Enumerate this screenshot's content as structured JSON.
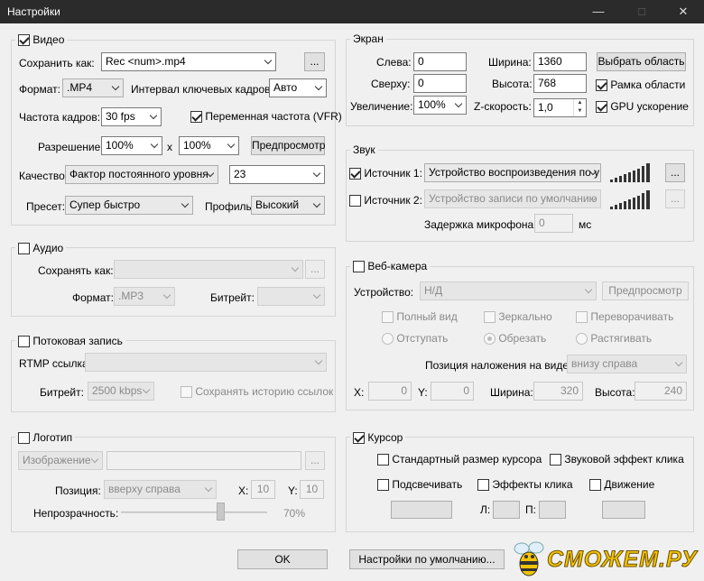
{
  "window": {
    "title": "Настройки"
  },
  "video": {
    "title": "Видео",
    "save_as_label": "Сохранить как:",
    "save_as_value": "Rec <num>.mp4",
    "browse": "...",
    "format_label": "Формат:",
    "format_value": ".MP4",
    "keyframe_label": "Интервал ключевых кадров:",
    "keyframe_value": "Авто",
    "fps_label": "Частота кадров:",
    "fps_value": "30 fps",
    "vfr_label": "Переменная частота (VFR)",
    "resolution_label": "Разрешение:",
    "res_w": "100%",
    "res_x": "x",
    "res_h": "100%",
    "preview": "Предпросмотр",
    "quality_label": "Качество:",
    "quality_value": "Фактор постоянного уровня",
    "quality_num": "23",
    "preset_label": "Пресет:",
    "preset_value": "Супер быстро",
    "profile_label": "Профиль:",
    "profile_value": "Высокий"
  },
  "audio": {
    "title": "Аудио",
    "save_as_label": "Сохранять как:",
    "browse": "...",
    "format_label": "Формат:",
    "format_value": ".MP3",
    "bitrate_label": "Битрейт:"
  },
  "stream": {
    "title": "Потоковая запись",
    "rtmp_label": "RTMP ссылка:",
    "bitrate_label": "Битрейт:",
    "bitrate_value": "2500 kbps",
    "history_label": "Сохранять историю ссылок"
  },
  "logo": {
    "title": "Логотип",
    "type_value": "Изображение",
    "browse": "...",
    "position_label": "Позиция:",
    "position_value": "вверху справа",
    "x_label": "X:",
    "x_value": "10",
    "y_label": "Y:",
    "y_value": "10",
    "opacity_label": "Непрозрачность:",
    "opacity_value": "70%"
  },
  "screen": {
    "title": "Экран",
    "left_label": "Слева:",
    "left_value": "0",
    "top_label": "Сверху:",
    "top_value": "0",
    "width_label": "Ширина:",
    "width_value": "1360",
    "height_label": "Высота:",
    "height_value": "768",
    "select_area": "Выбрать область",
    "frame_label": "Рамка области",
    "zoom_label": "Увеличение:",
    "zoom_value": "100%",
    "zspeed_label": "Z-скорость:",
    "zspeed_value": "1,0",
    "gpu_label": "GPU ускорение"
  },
  "sound": {
    "title": "Звук",
    "source1_label": "Источник 1:",
    "source1_value": "Устройство воспроизведения по у",
    "source2_label": "Источник 2:",
    "source2_value": "Устройство записи по умолчанию",
    "browse": "...",
    "mic_delay_label": "Задержка микрофона:",
    "mic_delay_value": "0",
    "mic_delay_unit": "мс"
  },
  "webcam": {
    "title": "Веб-камера",
    "device_label": "Устройство:",
    "device_value": "Н/Д",
    "preview": "Предпросмотр",
    "fullview": "Полный вид",
    "mirror": "Зеркально",
    "flip": "Переворачивать",
    "indent": "Отступать",
    "crop": "Обрезать",
    "stretch": "Растягивать",
    "overlay_label": "Позиция наложения на видео:",
    "overlay_value": "внизу справа",
    "x_label": "X:",
    "x_value": "0",
    "y_label": "Y:",
    "y_value": "0",
    "w_label": "Ширина:",
    "w_value": "320",
    "h_label": "Высота:",
    "h_value": "240"
  },
  "cursor": {
    "title": "Курсор",
    "std_size": "Стандартный размер курсора",
    "click_sound": "Звуковой эффект клика",
    "highlight": "Подсвечивать",
    "click_fx": "Эффекты клика",
    "motion": "Движение",
    "l_label": "Л:",
    "r_label": "П:"
  },
  "footer": {
    "ok": "OK",
    "defaults": "Настройки по умолчанию..."
  },
  "watermark": {
    "text": "СМОЖЕМ.РУ"
  }
}
